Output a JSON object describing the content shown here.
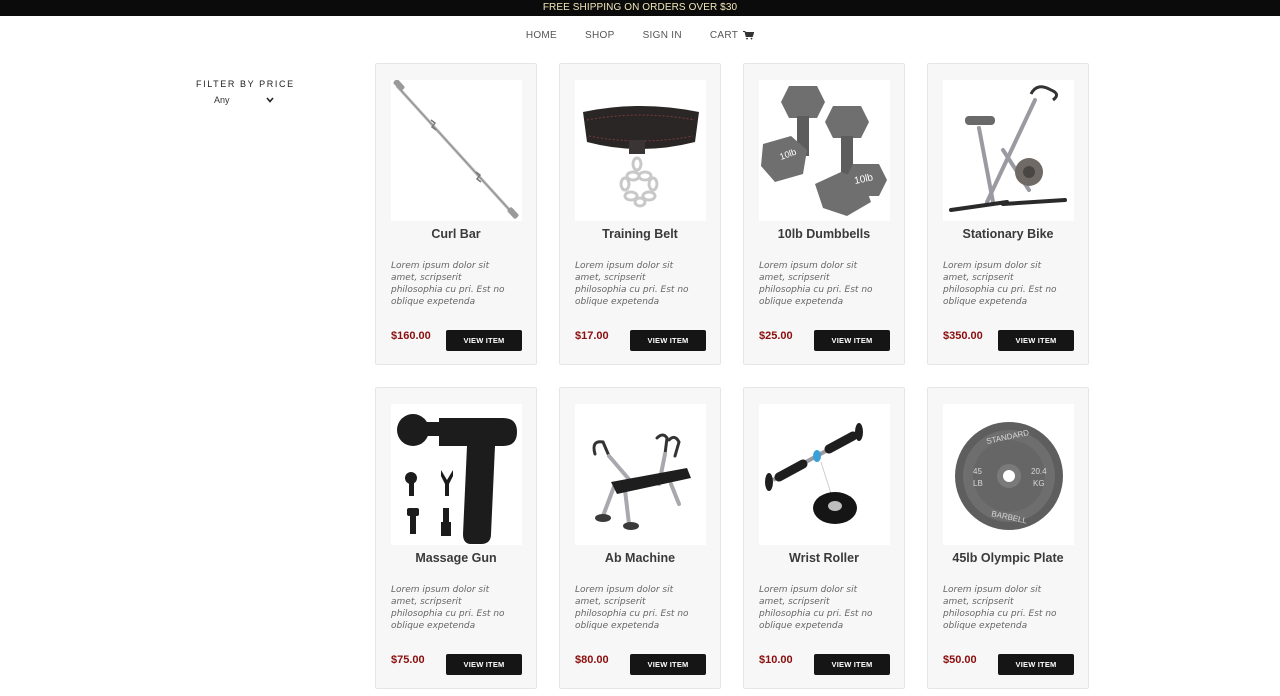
{
  "promo": {
    "text": "FREE SHIPPING ON ORDERS OVER $30"
  },
  "nav": {
    "home": "HOME",
    "shop": "SHOP",
    "sign_in": "SIGN IN",
    "cart": "CART"
  },
  "filter": {
    "title": "FILTER BY PRICE",
    "selected": "Any"
  },
  "products": [
    {
      "name": "Curl Bar",
      "description": "Lorem ipsum dolor sit amet, scripserit philosophia cu pri. Est no oblique expetenda",
      "price": "$160.00",
      "button": "VIEW ITEM",
      "image_icon": "curl-bar-image"
    },
    {
      "name": "Training Belt",
      "description": "Lorem ipsum dolor sit amet, scripserit philosophia cu pri. Est no oblique expetenda",
      "price": "$17.00",
      "button": "VIEW ITEM",
      "image_icon": "training-belt-image"
    },
    {
      "name": "10lb Dumbbells",
      "description": "Lorem ipsum dolor sit amet, scripserit philosophia cu pri. Est no oblique expetenda",
      "price": "$25.00",
      "button": "VIEW ITEM",
      "image_icon": "dumbbells-image"
    },
    {
      "name": "Stationary Bike",
      "description": "Lorem ipsum dolor sit amet, scripserit philosophia cu pri. Est no oblique expetenda",
      "price": "$350.00",
      "button": "VIEW ITEM",
      "image_icon": "stationary-bike-image"
    },
    {
      "name": "Massage Gun",
      "description": "Lorem ipsum dolor sit amet, scripserit philosophia cu pri. Est no oblique expetenda",
      "price": "$75.00",
      "button": "VIEW ITEM",
      "image_icon": "massage-gun-image"
    },
    {
      "name": "Ab Machine",
      "description": "Lorem ipsum dolor sit amet, scripserit philosophia cu pri. Est no oblique expetenda",
      "price": "$80.00",
      "button": "VIEW ITEM",
      "image_icon": "ab-machine-image"
    },
    {
      "name": "Wrist Roller",
      "description": "Lorem ipsum dolor sit amet, scripserit philosophia cu pri. Est no oblique expetenda",
      "price": "$10.00",
      "button": "VIEW ITEM",
      "image_icon": "wrist-roller-image"
    },
    {
      "name": "45lb Olympic Plate",
      "description": "Lorem ipsum dolor sit amet, scripserit philosophia cu pri. Est no oblique expetenda",
      "price": "$50.00",
      "button": "VIEW ITEM",
      "image_icon": "olympic-plate-image"
    }
  ],
  "colors": {
    "promo_bg": "#0b0b0b",
    "promo_text": "#f0e6b8",
    "price": "#8b0e0e",
    "button_bg": "#151515",
    "card_bg": "#f7f7f7"
  }
}
